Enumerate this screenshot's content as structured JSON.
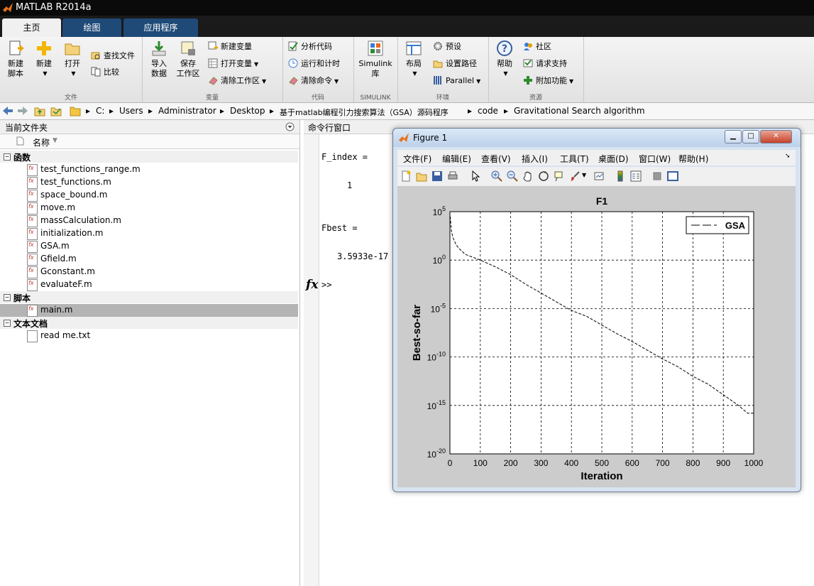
{
  "app": {
    "title": "MATLAB R2014a"
  },
  "tabs": [
    {
      "label": "主页"
    },
    {
      "label": "绘图"
    },
    {
      "label": "应用程序"
    }
  ],
  "ribbon": {
    "file": {
      "new_script": "新建\n脚本",
      "new": "新建",
      "open": "打开",
      "find_files": "查找文件",
      "compare": "比较",
      "group": "文件"
    },
    "variable": {
      "import": "导入\n数据",
      "save_ws": "保存\n工作区",
      "new_var": "新建变量",
      "open_var": "打开变量",
      "clear_ws": "清除工作区",
      "group": "变量"
    },
    "code": {
      "analyze": "分析代码",
      "run_time": "运行和计时",
      "clear_cmd": "清除命令",
      "group": "代码"
    },
    "simulink": {
      "lib": "Simulink\n库",
      "group": "SIMULINK"
    },
    "env": {
      "layout": "布局",
      "prefs": "预设",
      "set_path": "设置路径",
      "parallel": "Parallel",
      "group": "环境"
    },
    "resources": {
      "help": "帮助",
      "community": "社区",
      "support": "请求支持",
      "addons": "附加功能",
      "group": "资源"
    }
  },
  "address": {
    "crumbs": [
      "C:",
      "Users",
      "Administrator",
      "Desktop",
      "基于matlab编程引力搜索算法（GSA）源码程序",
      "code",
      "Gravitational Search algorithm"
    ]
  },
  "current_folder": {
    "title": "当前文件夹",
    "col_name": "名称",
    "sections": [
      {
        "label": "函数",
        "files": [
          "test_functions_range.m",
          "test_functions.m",
          "space_bound.m",
          "move.m",
          "massCalculation.m",
          "initialization.m",
          "GSA.m",
          "Gfield.m",
          "Gconstant.m",
          "evaluateF.m"
        ]
      },
      {
        "label": "脚本",
        "files": [
          "main.m"
        ]
      },
      {
        "label": "文本文档",
        "files": [
          "read me.txt"
        ]
      }
    ]
  },
  "command_window": {
    "title": "命令行窗口",
    "lines": [
      "F_index =",
      "1",
      "Fbest =",
      "3.5933e-17"
    ],
    "prompt": ">>",
    "fx": "fx"
  },
  "figure": {
    "title": "Figure 1",
    "menu": [
      "文件(F)",
      "编辑(E)",
      "查看(V)",
      "插入(I)",
      "工具(T)",
      "桌面(D)",
      "窗口(W)",
      "帮助(H)"
    ]
  },
  "chart_data": {
    "type": "line",
    "title": "F1",
    "xlabel": "Iteration",
    "ylabel": "Best-so-far",
    "yscale": "log",
    "xlim": [
      0,
      1000
    ],
    "ylim_exp": [
      -20,
      5
    ],
    "xticks": [
      0,
      100,
      200,
      300,
      400,
      500,
      600,
      700,
      800,
      900,
      1000
    ],
    "yticks_exp": [
      5,
      0,
      -5,
      -10,
      -15,
      -20
    ],
    "grid": true,
    "legend": {
      "position": "top-right",
      "entries": [
        "GSA"
      ]
    },
    "series": [
      {
        "name": "GSA",
        "line_style": "dashed",
        "x": [
          1,
          5,
          10,
          20,
          30,
          50,
          75,
          100,
          150,
          200,
          250,
          300,
          350,
          400,
          450,
          500,
          550,
          600,
          650,
          700,
          750,
          800,
          850,
          900,
          950,
          980,
          1000
        ],
        "log10y": [
          4.5,
          3.0,
          2.3,
          1.6,
          1.2,
          0.6,
          0.3,
          0.0,
          -0.7,
          -1.5,
          -2.5,
          -3.4,
          -4.3,
          -5.2,
          -5.8,
          -6.7,
          -7.6,
          -8.4,
          -9.3,
          -10.2,
          -11.0,
          -12.0,
          -12.8,
          -13.9,
          -15.0,
          -15.8,
          -15.8
        ]
      }
    ]
  }
}
